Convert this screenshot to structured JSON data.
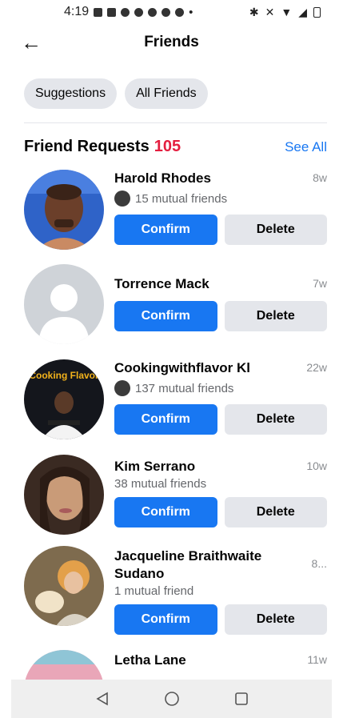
{
  "status": {
    "time": "4:19"
  },
  "header": {
    "title": "Friends",
    "back_icon": "arrow-left-icon"
  },
  "chips": [
    "Suggestions",
    "All Friends"
  ],
  "section": {
    "title": "Friend Requests",
    "count": "105",
    "see_all": "See All"
  },
  "requests": [
    {
      "name": "Harold Rhodes",
      "age": "8w",
      "mutual": "15 mutual friends",
      "confirm": "Confirm",
      "delete": "Delete"
    },
    {
      "name": "Torrence Mack",
      "age": "7w",
      "confirm": "Confirm",
      "delete": "Delete"
    },
    {
      "name": "Cookingwithflavor Kl",
      "age": "22w",
      "mutual": "137 mutual friends",
      "avatar_text": "Cooking Flavor",
      "confirm": "Confirm",
      "delete": "Delete"
    },
    {
      "name": "Kim Serrano",
      "age": "10w",
      "mutual": "38 mutual friends",
      "confirm": "Confirm",
      "delete": "Delete"
    },
    {
      "name": "Jacqueline Braithwaite Sudano",
      "age": "8...",
      "mutual": "1 mutual friend",
      "confirm": "Confirm",
      "delete": "Delete"
    },
    {
      "name": "Letha Lane",
      "age": "11w"
    }
  ],
  "colors": {
    "accent": "#1877f2",
    "count_red": "#e41e3f",
    "secondary_bg": "#e4e6eb"
  }
}
